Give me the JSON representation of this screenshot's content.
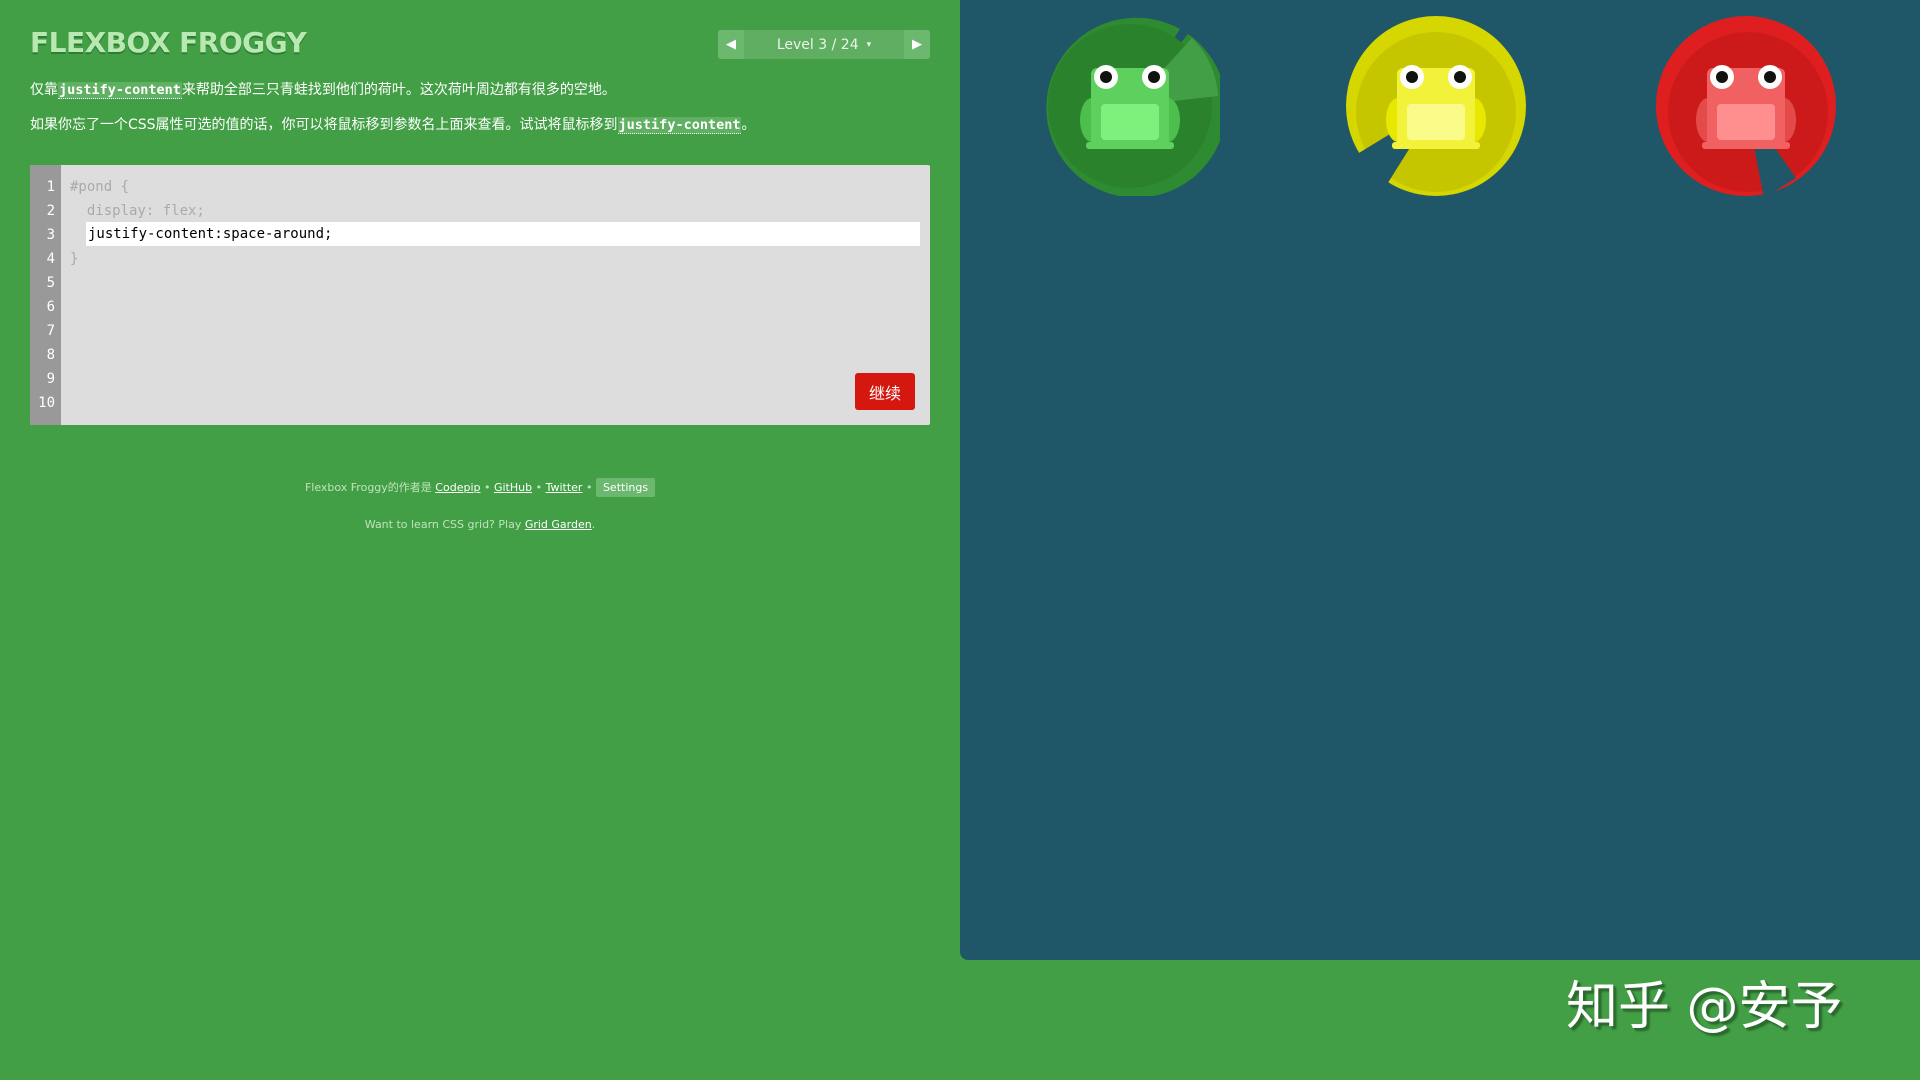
{
  "header": {
    "logo": "FLEXBOX FROGGY",
    "level_label": "Level 3 / 24",
    "caret": "▾",
    "prev_arrow": "◀",
    "next_arrow": "▶"
  },
  "instructions": {
    "line1_pre": "仅靠",
    "line1_code": "justify-content",
    "line1_post": "来帮助全部三只青蛙找到他们的荷叶。这次荷叶周边都有很多的空地。",
    "line2_pre": "如果你忘了一个CSS属性可选的值的话，你可以将鼠标移到参数名上面来查看。试试将鼠标移到",
    "line2_code": "justify-content",
    "line2_post": "。"
  },
  "editor": {
    "line_numbers": [
      "1",
      "2",
      "3",
      "4",
      "5",
      "6",
      "7",
      "8",
      "9",
      "10"
    ],
    "line1": "#pond {",
    "line2": "  display: flex;",
    "input_value": "justify-content:space-around;",
    "line4": "}",
    "next_button": "继续"
  },
  "credits": {
    "prefix": "Flexbox Froggy的作者是 ",
    "codepip": "Codepip",
    "sep": " • ",
    "github": "GitHub",
    "twitter": "Twitter",
    "settings": "Settings",
    "grid_prefix": "Want to learn CSS grid? Play ",
    "grid_link": "Grid Garden",
    "grid_suffix": "."
  },
  "pond": {
    "frogs": [
      {
        "color": "green",
        "pad": "#2f8b31",
        "body": "#5ed05e",
        "belly": "#7ef07c"
      },
      {
        "color": "yellow",
        "pad": "#d6d600",
        "body": "#f2f23a",
        "belly": "#fbfb8a"
      },
      {
        "color": "red",
        "pad": "#df1f1f",
        "body": "#f26161",
        "belly": "#ff8f8f"
      }
    ]
  },
  "watermark": "知乎 @安予"
}
